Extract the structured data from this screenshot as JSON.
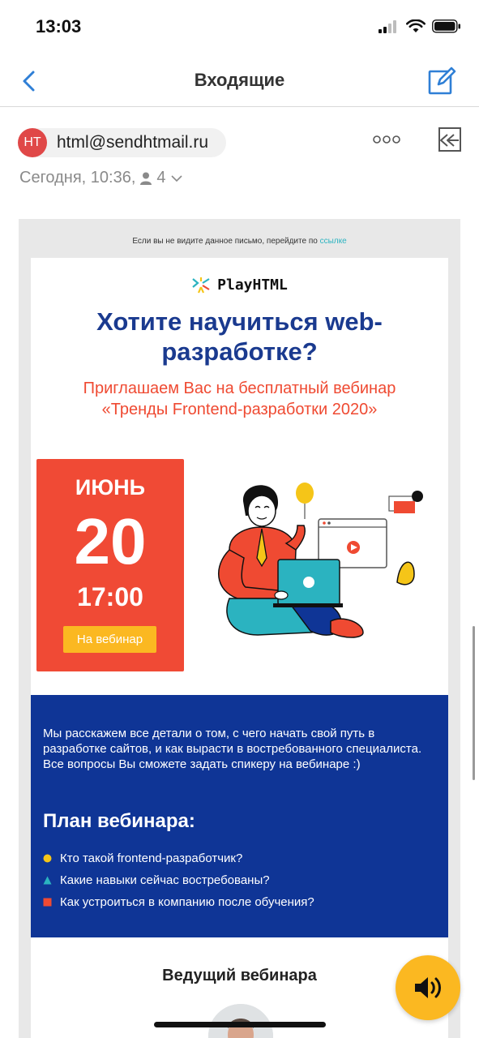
{
  "status": {
    "time": "13:03"
  },
  "nav": {
    "title": "Входящие",
    "back_icon": "chevron-left-icon",
    "compose_icon": "compose-icon"
  },
  "sender": {
    "initials": "HT",
    "email": "html@sendhtmail.ru"
  },
  "meta": {
    "date": "Сегодня, 10:36,",
    "recipients_count": "4"
  },
  "email": {
    "preheader_text": "Если вы не видите данное письмо, перейдите по ",
    "preheader_link": "ссылке",
    "brand": "PlayHTML",
    "headline": "Хотите научиться web-разработке?",
    "subline": "Приглашаем Вас на бесплатный вебинар «Тренды Frontend-разработки 2020»",
    "date_month": "ИЮНЬ",
    "date_day": "20",
    "date_time": "17:00",
    "webinar_button": "На вебинар",
    "intro_text": "Мы расскажем все детали о том, с чего начать свой путь в разработке сайтов, и как вырасти в востребованного специалиста. Все вопросы Вы сможете задать спикеру на вебинаре :)",
    "plan_title": "План вебинара:",
    "plan_items": [
      {
        "text": "Кто такой frontend-разработчик?",
        "color": "#f5c518",
        "shape": "circle"
      },
      {
        "text": "Какие навыки сейчас востребованы?",
        "color": "#2bb3c0",
        "shape": "triangle"
      },
      {
        "text": "Как устроиться в компанию после обучения?",
        "color": "#ef4a32",
        "shape": "square"
      }
    ],
    "host_title": "Ведущий вебинара"
  },
  "colors": {
    "accent_blue": "#1a3a8f",
    "accent_red": "#f04a35",
    "accent_yellow": "#fbb821",
    "ios_blue": "#2f7fd6"
  }
}
